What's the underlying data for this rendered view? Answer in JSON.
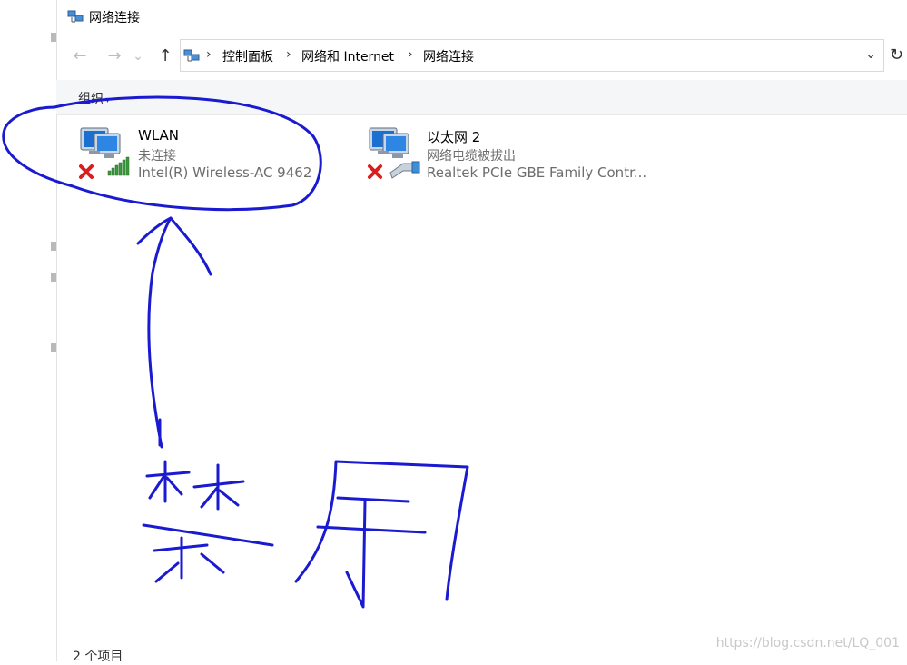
{
  "window": {
    "title": "网络连接"
  },
  "navigation": {
    "back_label": "←",
    "forward_label": "→",
    "recent_label": "⌄",
    "up_label": "↑",
    "breadcrumb": [
      "控制面板",
      "网络和 Internet",
      "网络连接"
    ],
    "separator": "›",
    "dropdown_label": "⌄",
    "refresh_label": "↻"
  },
  "toolbar": {
    "organize_label": "组织",
    "organize_caret": "▾"
  },
  "connections": [
    {
      "name": "WLAN",
      "status": "未连接",
      "device": "Intel(R) Wireless-AC 9462",
      "type": "wireless"
    },
    {
      "name": "以太网 2",
      "status": "网络电缆被拔出",
      "device": "Realtek PCIe GBE Family Contr...",
      "type": "ethernet"
    }
  ],
  "statusbar": {
    "item_count": "2 个项目"
  },
  "watermark": "https://blog.csdn.net/LQ_001",
  "colors": {
    "annotation_ink": "#1a1ad0",
    "error_red": "#d81e1e",
    "signal_green": "#3a9a3a"
  }
}
